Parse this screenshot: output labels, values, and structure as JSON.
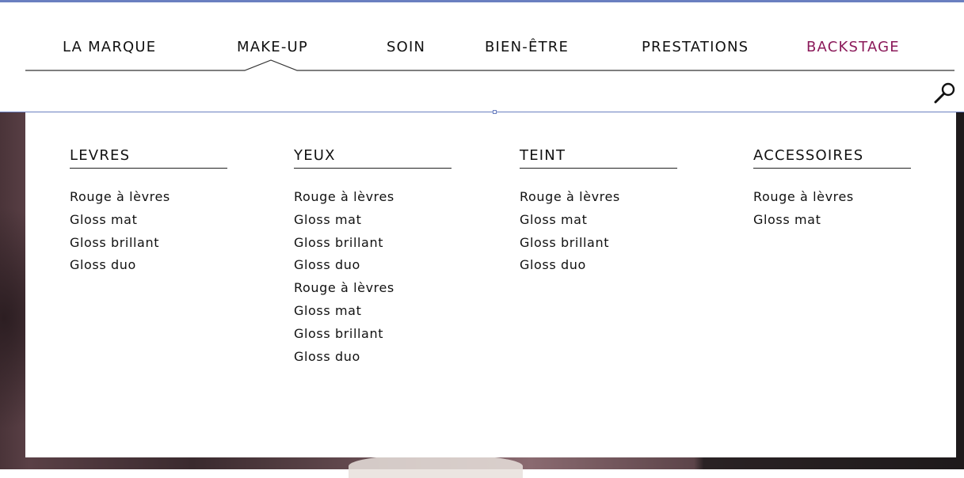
{
  "nav": {
    "items": [
      {
        "label": "LA MARQUE"
      },
      {
        "label": "MAKE-UP"
      },
      {
        "label": "SOIN"
      },
      {
        "label": "BIEN-ÊTRE"
      },
      {
        "label": "PRESTATIONS"
      },
      {
        "label": "BACKSTAGE"
      }
    ],
    "active": "MAKE-UP",
    "highlight_color": "#8b1a5a"
  },
  "search": {
    "icon": "search-icon"
  },
  "mega_menu": {
    "columns": [
      {
        "title": "LEVRES",
        "items": [
          "Rouge à lèvres",
          "Gloss mat",
          "Gloss brillant",
          "Gloss duo"
        ]
      },
      {
        "title": "YEUX",
        "items": [
          "Rouge à lèvres",
          "Gloss mat",
          "Gloss brillant",
          "Gloss duo",
          "Rouge à lèvres",
          "Gloss mat",
          "Gloss brillant",
          "Gloss duo"
        ]
      },
      {
        "title": "TEINT",
        "items": [
          "Rouge à lèvres",
          "Gloss mat",
          "Gloss brillant",
          "Gloss duo"
        ]
      },
      {
        "title": "ACCESSOIRES",
        "items": [
          "Rouge à lèvres",
          "Gloss mat"
        ]
      }
    ]
  },
  "colors": {
    "accent": "#6a7fc0",
    "text": "#111111"
  }
}
